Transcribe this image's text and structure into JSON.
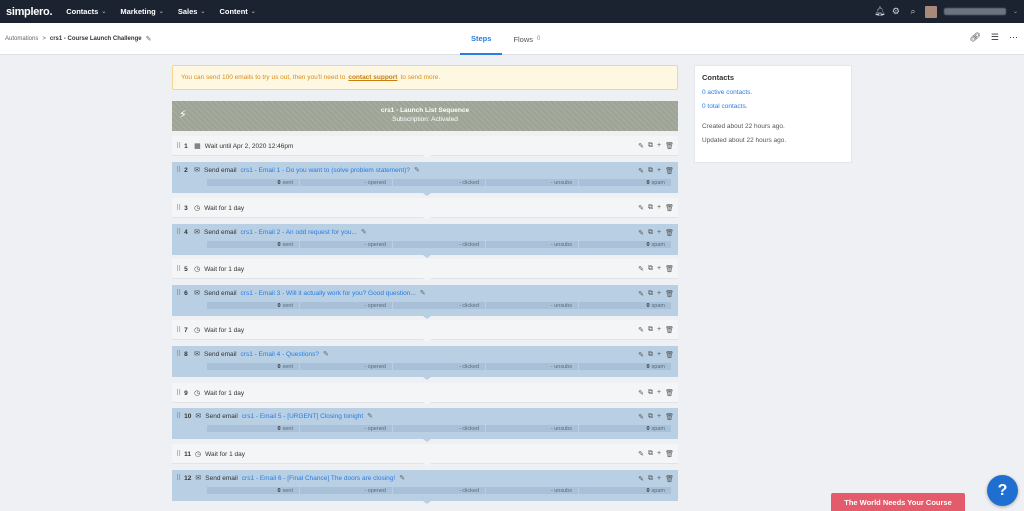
{
  "nav": {
    "logo": "simplero.",
    "items": [
      {
        "label": "Contacts"
      },
      {
        "label": "Marketing"
      },
      {
        "label": "Sales"
      },
      {
        "label": "Content"
      }
    ],
    "icons": [
      "bell-icon",
      "gear-icon",
      "search-icon"
    ]
  },
  "breadcrumb": {
    "root": "Automations",
    "separator": ">",
    "current": "crs1 - Course Launch Challenge"
  },
  "tabs": [
    {
      "label": "Steps",
      "count": ""
    },
    {
      "label": "Flows",
      "count": "0"
    }
  ],
  "alert": {
    "before": "You can send 100 emails to try us out, then you'll need to",
    "link": "contact support",
    "after": "to send more."
  },
  "sequence": {
    "title": "crs1 - Launch List Sequence",
    "subtitle": "Subscription: Activated"
  },
  "steps": [
    {
      "num": "1",
      "kind": "wait",
      "text": "Wait until Apr 2, 2020 12:46pm"
    },
    {
      "num": "2",
      "kind": "email",
      "prefix": "Send email",
      "subject": "crs1 - Email 1 - Do you want to (solve problem statement)?"
    },
    {
      "num": "3",
      "kind": "wait",
      "text": "Wait for 1 day"
    },
    {
      "num": "4",
      "kind": "email",
      "prefix": "Send email",
      "subject": "crs1 - Email 2 - An odd request for you..."
    },
    {
      "num": "5",
      "kind": "wait",
      "text": "Wait for 1 day"
    },
    {
      "num": "6",
      "kind": "email",
      "prefix": "Send email",
      "subject": "crs1 - Email 3 - Will it actually work for you? Good question..."
    },
    {
      "num": "7",
      "kind": "wait",
      "text": "Wait for 1 day"
    },
    {
      "num": "8",
      "kind": "email",
      "prefix": "Send email",
      "subject": "crs1 - Email 4 - Questions?"
    },
    {
      "num": "9",
      "kind": "wait",
      "text": "Wait for 1 day"
    },
    {
      "num": "10",
      "kind": "email",
      "prefix": "Send email",
      "subject": "crs1 - Email 5 - [URGENT] Closing tonight"
    },
    {
      "num": "11",
      "kind": "wait",
      "text": "Wait for 1 day"
    },
    {
      "num": "12",
      "kind": "email",
      "prefix": "Send email",
      "subject": "crs1 - Email 6 - [Final Chance] The doors are closing!"
    }
  ],
  "stats": {
    "sent_value": "0",
    "sent_label": "sent",
    "opened": "- opened",
    "clicked": "- clicked",
    "unsubs": "- unsubs",
    "spam_value": "0",
    "spam_label": "spam"
  },
  "contacts": {
    "title": "Contacts",
    "active": "0 active contacts.",
    "total": "0 total contacts.",
    "created": "Created about 22 hours ago.",
    "updated": "Updated about 22 hours ago."
  },
  "promo": "The World Needs Your Course",
  "help": "?",
  "colors": {
    "nav_bg": "#1b2330",
    "accent": "#2a7de1",
    "email_row": "#b8cfe4",
    "promo": "#e45b6b"
  }
}
